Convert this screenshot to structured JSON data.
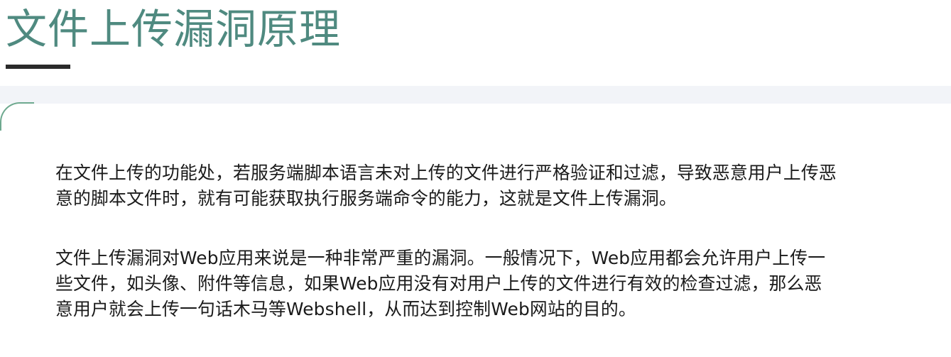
{
  "slide": {
    "title": "文件上传漏洞原理",
    "paragraph1": {
      "lines": [
        "在文件上传的功能处，若服务端脚本语言未对上传的文件进行严格验证和过滤，导致恶意用户上传恶",
        "意的脚本文件时，就有可能获取执行服务端命令的能力，这就是文件上传漏洞。"
      ]
    },
    "paragraph2": {
      "lines": [
        "文件上传漏洞对Web应用来说是一种非常严重的漏洞。一般情况下，Web应用都会允许用户上传一",
        "些文件，如头像、附件等信息，如果Web应用没有对用户上传的文件进行有效的检查过滤，那么恶",
        "意用户就会上传一句话木马等Webshell，从而达到控制Web网站的目的。"
      ]
    },
    "colors": {
      "title": "#4f8a80",
      "underline": "#2a2a2a",
      "band": "#f2f4f8",
      "corner_accent": "#6ea98f",
      "body_text": "#1a1a1a"
    }
  }
}
